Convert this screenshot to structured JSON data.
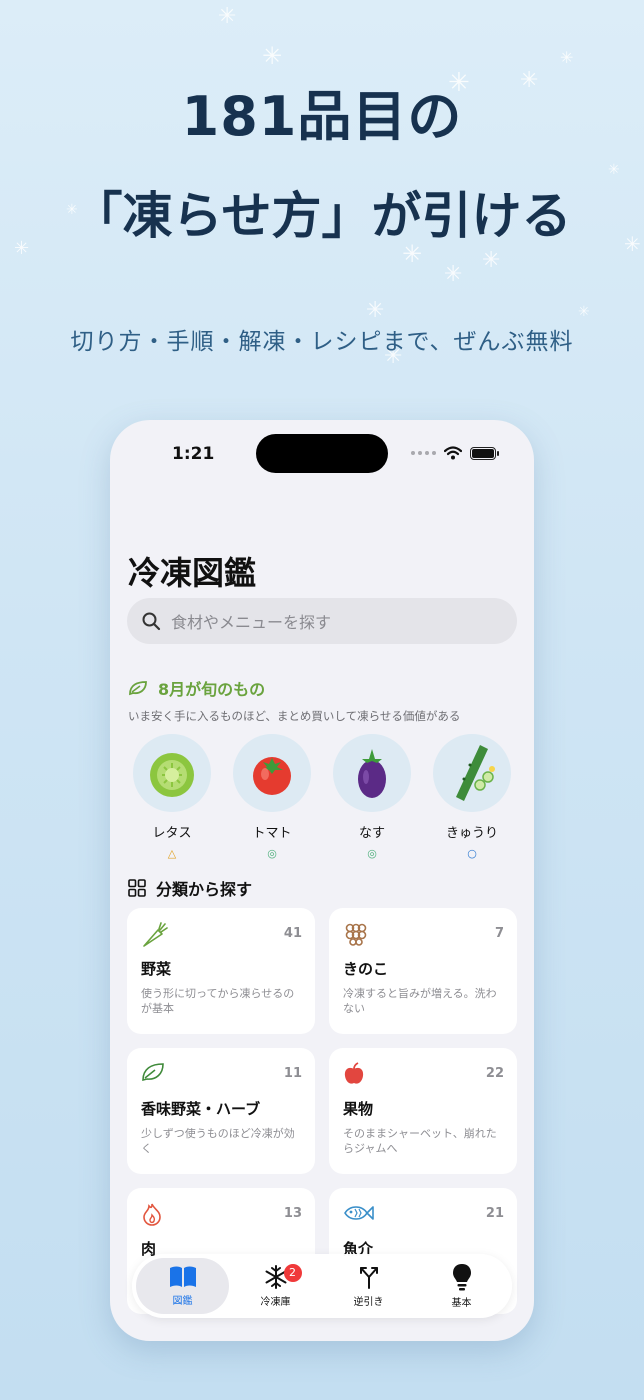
{
  "promo": {
    "headline_line1": "181品目の",
    "headline_line2": "「凍らせ方」が引ける",
    "subline": "切り方・手順・解凍・レシピまで、ぜんぶ無料"
  },
  "status": {
    "time": "1:21"
  },
  "page_title": "冷凍図鑑",
  "search": {
    "placeholder": "食材やメニューを探す"
  },
  "season": {
    "title": "8月が旬のもの",
    "description": "いま安く手に入るものほど、まとめ買いして凍らせる価値がある",
    "items": [
      {
        "name": "レタス",
        "mark": "△",
        "mark_color": "#e0a020"
      },
      {
        "name": "トマト",
        "mark": "◎",
        "mark_color": "#4caf7a"
      },
      {
        "name": "なす",
        "mark": "◎",
        "mark_color": "#4caf7a"
      },
      {
        "name": "きゅうり",
        "mark": "○",
        "mark_color": "#2e7ad1"
      }
    ]
  },
  "categories": {
    "title": "分類から探す",
    "items": [
      {
        "name": "野菜",
        "count": "41",
        "description": "使う形に切ってから凍らせるのが基本",
        "icon": "carrot-icon"
      },
      {
        "name": "きのこ",
        "count": "7",
        "description": "冷凍すると旨みが増える。洗わない",
        "icon": "mushroom-icon"
      },
      {
        "name": "香味野菜・ハーブ",
        "count": "11",
        "description": "少しずつ使うものほど冷凍が効く",
        "icon": "leaf-icon"
      },
      {
        "name": "果物",
        "count": "22",
        "description": "そのままシャーベット、崩れたらジャムへ",
        "icon": "apple-icon"
      },
      {
        "name": "肉",
        "count": "13",
        "description": "",
        "icon": "flame-icon"
      },
      {
        "name": "魚介",
        "count": "21",
        "description": "",
        "icon": "fish-icon"
      }
    ]
  },
  "tabbar": {
    "tabs": [
      {
        "label": "図鑑",
        "active": true
      },
      {
        "label": "冷凍庫",
        "badge": "2"
      },
      {
        "label": "逆引き"
      },
      {
        "label": "基本"
      }
    ]
  },
  "colors": {
    "accent": "#1a73e8",
    "season_green": "#6aa33e",
    "badge_red": "#f0393a",
    "headline": "#17324f"
  }
}
